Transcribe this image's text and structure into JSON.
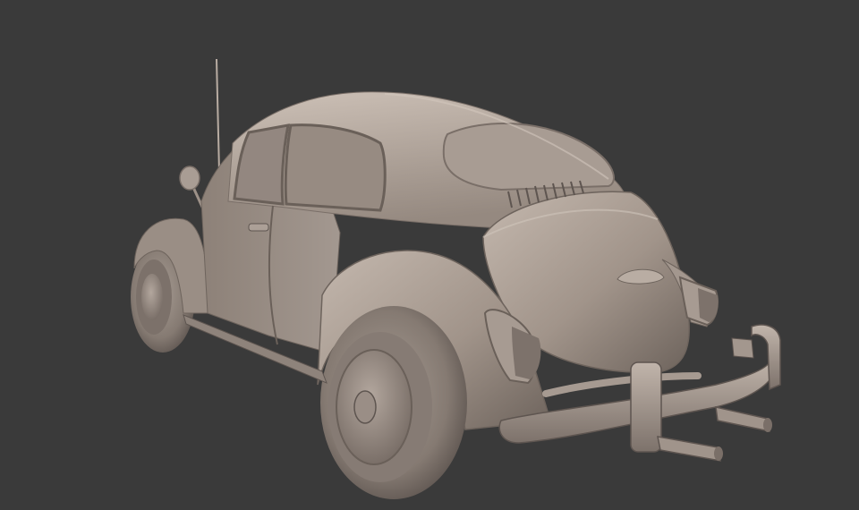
{
  "scene": {
    "subject": "car-beetle-clay-render",
    "colors": {
      "background": "#3a3a3a",
      "clay_base": "#9c8f86",
      "clay_light": "#c2b6ac",
      "clay_dark": "#6a6059",
      "clay_shadow": "#4a433f",
      "tire": "#8a7f78"
    }
  }
}
